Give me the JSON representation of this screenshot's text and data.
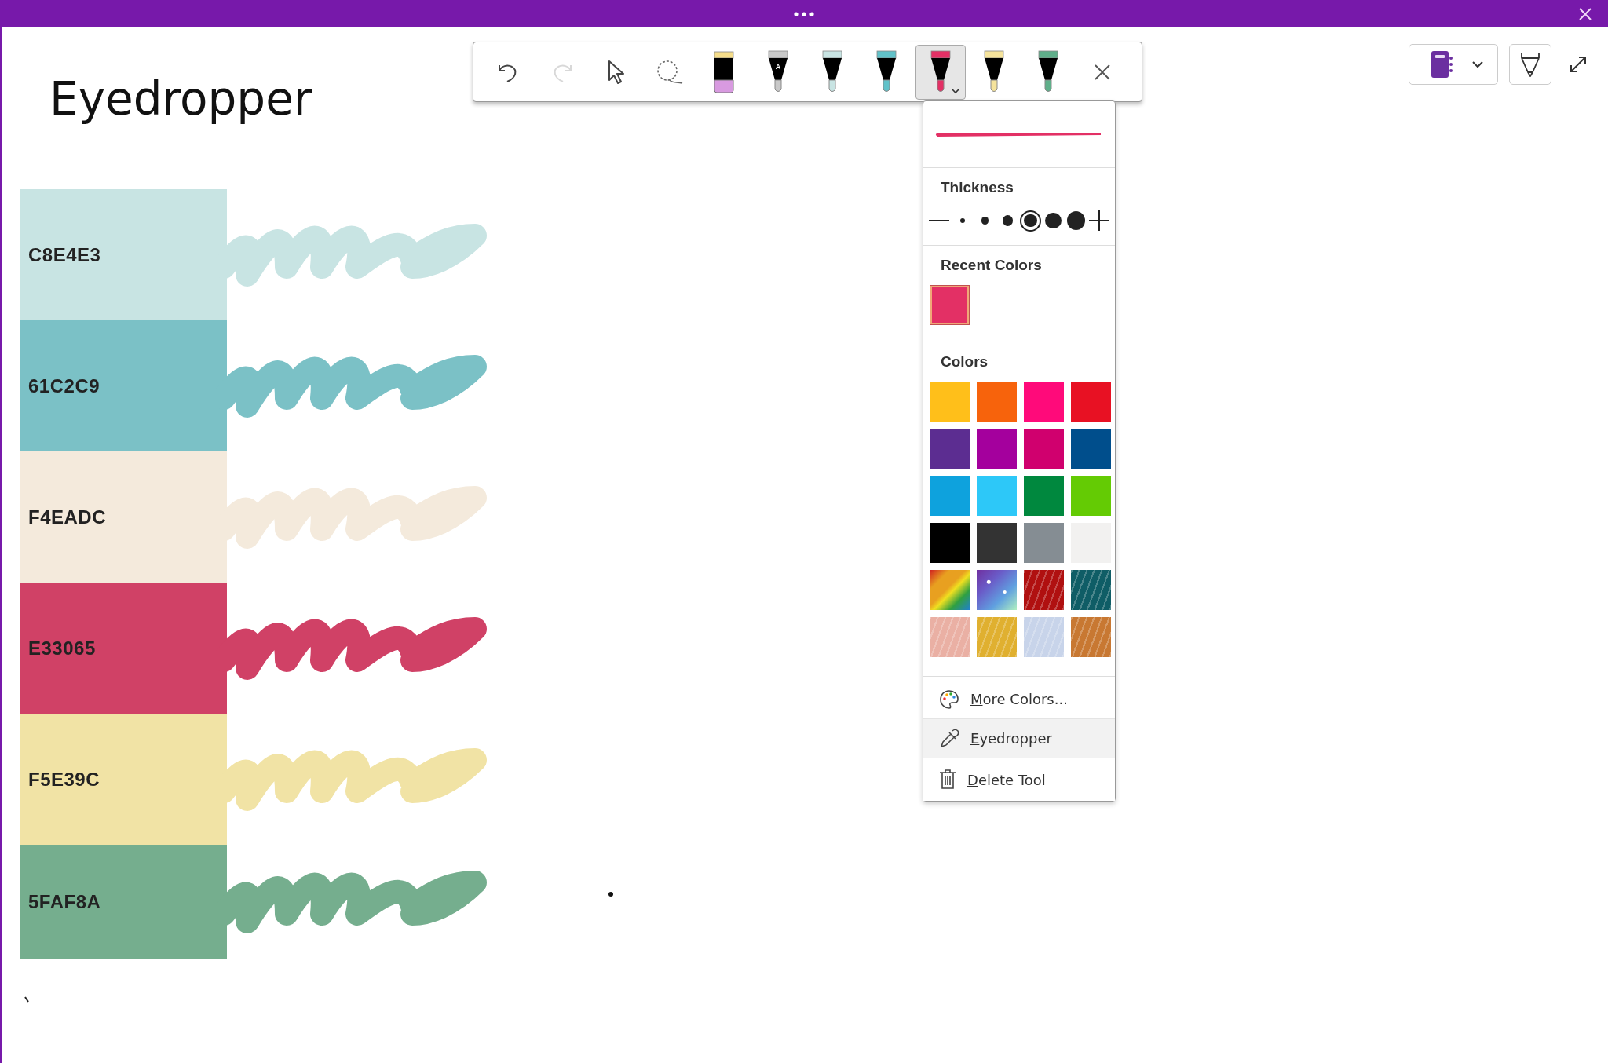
{
  "page": {
    "title": "Eyedropper"
  },
  "swatches": [
    {
      "label": "C8E4E3",
      "color": "#c8e4e3"
    },
    {
      "label": "61C2C9",
      "color": "#7bc1c6"
    },
    {
      "label": "F4EADC",
      "color": "#f4eadc"
    },
    {
      "label": "E33065",
      "color": "#d04166"
    },
    {
      "label": "F5E39C",
      "color": "#f1e3a5"
    },
    {
      "label": "5FAF8A",
      "color": "#75ae8e"
    }
  ],
  "toolbar": {
    "tools": [
      {
        "kind": "undo",
        "selected": false,
        "disabled": false
      },
      {
        "kind": "redo",
        "selected": false,
        "disabled": true
      },
      {
        "kind": "select",
        "selected": false,
        "disabled": false
      },
      {
        "kind": "lasso",
        "selected": false,
        "disabled": false
      },
      {
        "kind": "highlighter",
        "color": "#d89ae0",
        "selected": false,
        "disabled": false
      },
      {
        "kind": "pen",
        "color": "#c8c8c8",
        "mark": "A",
        "selected": false,
        "disabled": false
      },
      {
        "kind": "pen",
        "color": "#c8e4e3",
        "selected": false,
        "disabled": false
      },
      {
        "kind": "pen",
        "color": "#61c2c9",
        "selected": false,
        "disabled": false
      },
      {
        "kind": "pen",
        "color": "#e33065",
        "selected": true,
        "disabled": false
      },
      {
        "kind": "pen",
        "color": "#f5e39c",
        "selected": false,
        "disabled": false
      },
      {
        "kind": "pen",
        "color": "#5faf8a",
        "selected": false,
        "disabled": false
      },
      {
        "kind": "close",
        "selected": false,
        "disabled": false
      }
    ]
  },
  "pen_menu": {
    "preview": {
      "color": "#e33065"
    },
    "thickness_label": "Thickness",
    "thickness_options": [
      {
        "selected": false
      },
      {
        "selected": false
      },
      {
        "selected": false
      },
      {
        "selected": true
      },
      {
        "selected": false
      },
      {
        "selected": false
      }
    ],
    "recent_label": "Recent Colors",
    "recent_colors": [
      {
        "color": "#e33065",
        "selected": true
      }
    ],
    "colors_label": "Colors",
    "colors": [
      {
        "kind": "solid",
        "color": "#ffbf1a"
      },
      {
        "kind": "solid",
        "color": "#f7630c"
      },
      {
        "kind": "solid",
        "color": "#ff0a7a"
      },
      {
        "kind": "solid",
        "color": "#e81123"
      },
      {
        "kind": "solid",
        "color": "#5c2d91"
      },
      {
        "kind": "solid",
        "color": "#a4009d"
      },
      {
        "kind": "solid",
        "color": "#d0006e"
      },
      {
        "kind": "solid",
        "color": "#004e8c"
      },
      {
        "kind": "solid",
        "color": "#0ea2dd"
      },
      {
        "kind": "solid",
        "color": "#2dc8f8"
      },
      {
        "kind": "solid",
        "color": "#00883e"
      },
      {
        "kind": "solid",
        "color": "#64cb04"
      },
      {
        "kind": "solid",
        "color": "#000000"
      },
      {
        "kind": "solid",
        "color": "#333333"
      },
      {
        "kind": "solid",
        "color": "#858d93"
      },
      {
        "kind": "solid",
        "color": "#f2f1f0"
      },
      {
        "kind": "rainbow",
        "color": "#e8a020"
      },
      {
        "kind": "galaxy",
        "color": "#6a5cc8"
      },
      {
        "kind": "texture",
        "color": "#b01010"
      },
      {
        "kind": "texture",
        "color": "#0f5d66"
      },
      {
        "kind": "texture",
        "color": "#eab0a4"
      },
      {
        "kind": "texture",
        "color": "#e0b030"
      },
      {
        "kind": "texture",
        "color": "#c8d4ea"
      },
      {
        "kind": "texture",
        "color": "#c87832"
      }
    ],
    "items": [
      {
        "kind": "palette",
        "label": "More Colors...",
        "highlighted": false
      },
      {
        "kind": "eyedropper",
        "label": "Eyedropper",
        "highlighted": true
      },
      {
        "kind": "trash",
        "label": "Delete Tool",
        "highlighted": false
      }
    ]
  }
}
